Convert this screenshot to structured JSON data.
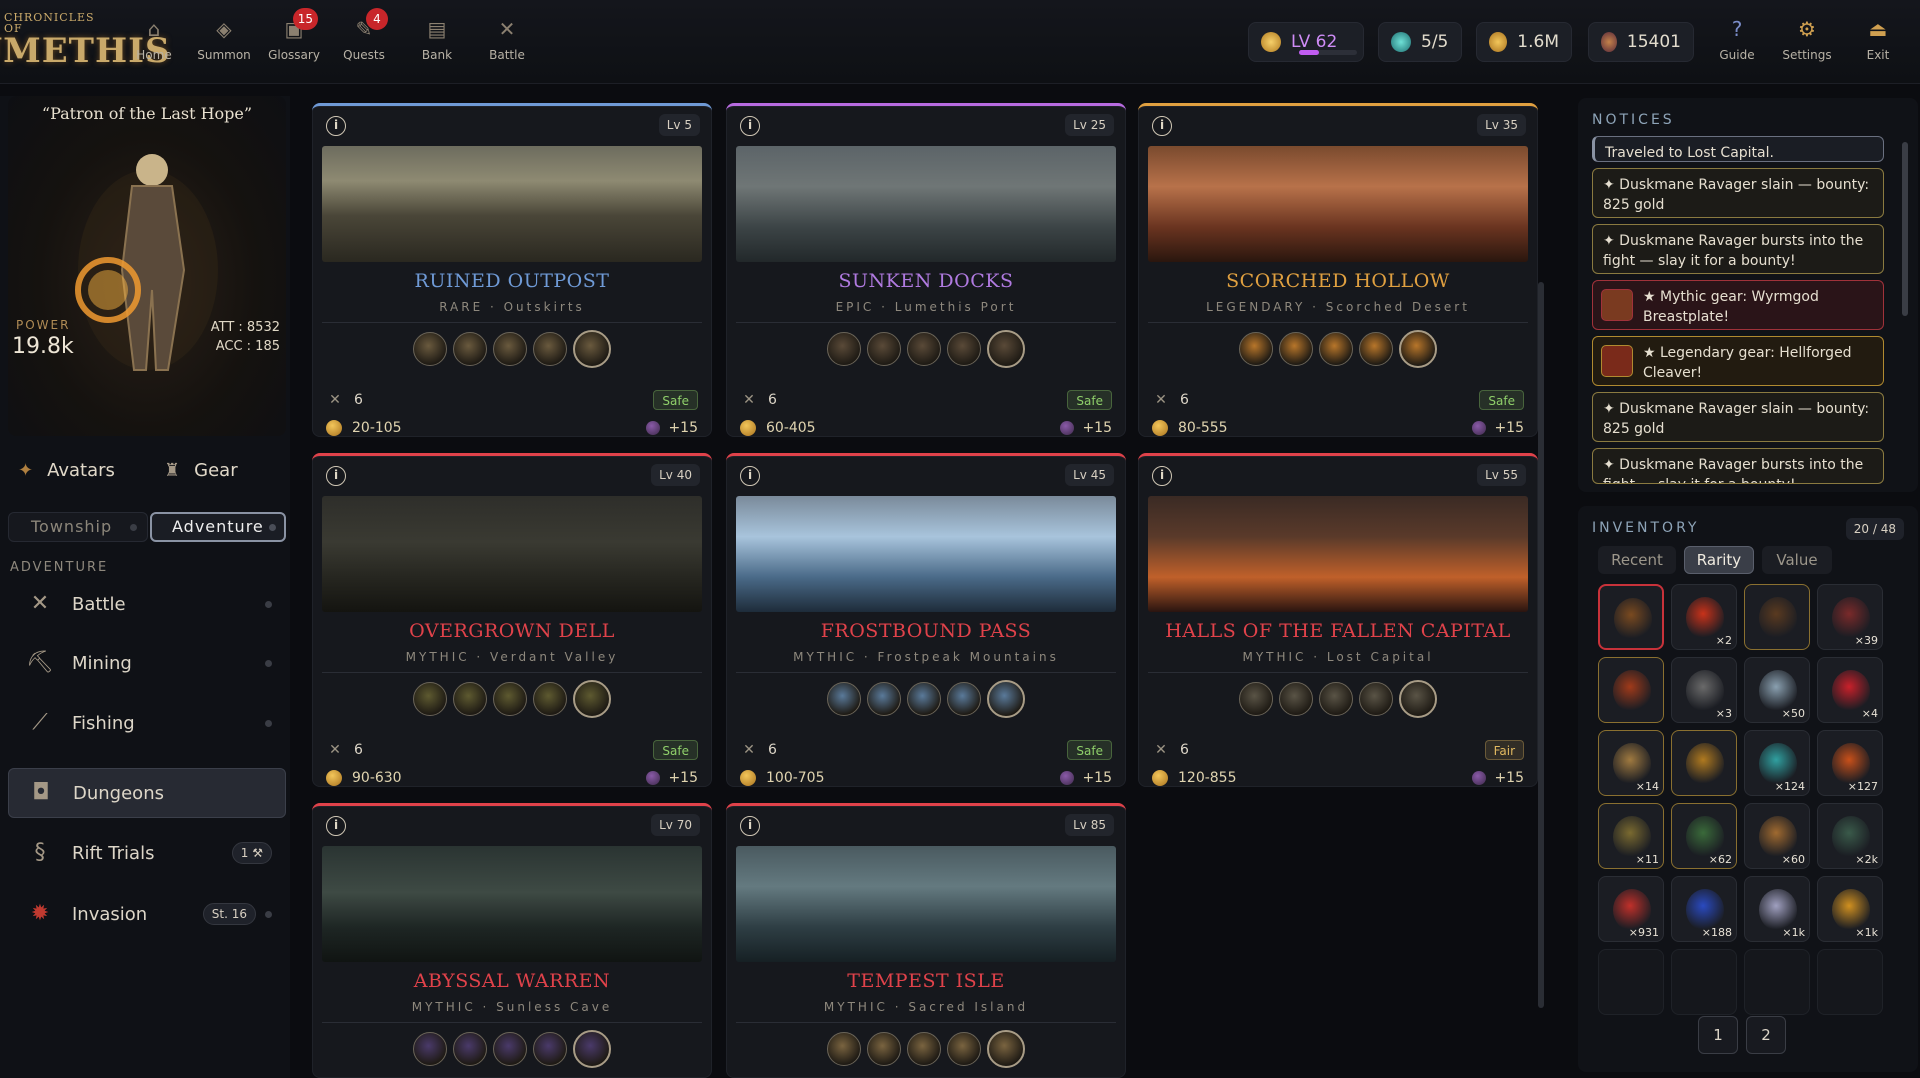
{
  "app": {
    "logo_line1": "CHRONICLES OF",
    "logo_line2": "LUMETHIS"
  },
  "nav": {
    "home": "Home",
    "summon": "Summon",
    "glossary": "Glossary",
    "glossary_badge": "15",
    "quests": "Quests",
    "quests_badge": "4",
    "bank": "Bank",
    "battle": "Battle",
    "guide": "Guide",
    "settings": "Settings",
    "exit": "Exit"
  },
  "resources": {
    "level": "LV 62",
    "level_progress": 0.35,
    "energy": "5/5",
    "gold": "1.6M",
    "gems": "15401"
  },
  "hero": {
    "title": "“Patron of the Last Hope”",
    "power_label": "POWER",
    "power": "19.8k",
    "att": "ATT : 8532",
    "acc": "ACC : 185"
  },
  "left": {
    "avatars": "Avatars",
    "gear": "Gear",
    "tab_township": "Township",
    "tab_adventure": "Adventure",
    "section": "ADVENTURE",
    "items": [
      {
        "label": "Battle"
      },
      {
        "label": "Mining"
      },
      {
        "label": "Fishing"
      },
      {
        "label": "Dungeons"
      },
      {
        "label": "Rift Trials",
        "tag": "1 ⚒"
      },
      {
        "label": "Invasion",
        "tag": "St. 16"
      }
    ]
  },
  "dungeons": [
    {
      "lv": "Lv 5",
      "name": "RUINED OUTPOST",
      "sub": "RARE · Outskirts",
      "players": "6",
      "status": "Safe",
      "gold": "20-105",
      "bonus": "+15"
    },
    {
      "lv": "Lv 25",
      "name": "SUNKEN DOCKS",
      "sub": "EPIC · Lumethis Port",
      "players": "6",
      "status": "Safe",
      "gold": "60-405",
      "bonus": "+15"
    },
    {
      "lv": "Lv 35",
      "name": "SCORCHED HOLLOW",
      "sub": "LEGENDARY · Scorched Desert",
      "players": "6",
      "status": "Safe",
      "gold": "80-555",
      "bonus": "+15"
    },
    {
      "lv": "Lv 40",
      "name": "OVERGROWN DELL",
      "sub": "MYTHIC · Verdant Valley",
      "players": "6",
      "status": "Safe",
      "gold": "90-630",
      "bonus": "+15"
    },
    {
      "lv": "Lv 45",
      "name": "FROSTBOUND PASS",
      "sub": "MYTHIC · Frostpeak Mountains",
      "players": "6",
      "status": "Safe",
      "gold": "100-705",
      "bonus": "+15"
    },
    {
      "lv": "Lv 55",
      "name": "HALLS OF THE FALLEN CAPITAL",
      "sub": "MYTHIC · Lost Capital",
      "players": "6",
      "status": "Fair",
      "gold": "120-855",
      "bonus": "+15"
    },
    {
      "lv": "Lv 70",
      "name": "ABYSSAL WARREN",
      "sub": "MYTHIC · Sunless Cave"
    },
    {
      "lv": "Lv 85",
      "name": "TEMPEST ISLE",
      "sub": "MYTHIC · Sacred Island"
    }
  ],
  "notices": {
    "title": "NOTICES",
    "items": [
      "Traveled to Lost Capital.",
      "✦ Duskmane Ravager slain — bounty: 825 gold",
      "✦ Duskmane Ravager bursts into the fight — slay it for a bounty!",
      "★ Mythic gear: Wyrmgod Breastplate!",
      "★ Legendary gear: Hellforged Cleaver!",
      "✦ Duskmane Ravager slain — bounty: 825 gold",
      "✦ Duskmane Ravager bursts into the fight — slay it for a bounty!"
    ]
  },
  "inventory": {
    "title": "INVENTORY",
    "count": "20 / 48",
    "tabs": [
      "Recent",
      "Rarity",
      "Value"
    ],
    "counts": [
      "",
      "×2",
      "",
      "×39",
      "",
      "×3",
      "×50",
      "×4",
      "×14",
      "",
      "×124",
      "×127",
      "×11",
      "×62",
      "×60",
      "×2k",
      "×931",
      "×188",
      "×1k",
      "×1k"
    ],
    "pages": [
      "1",
      "2"
    ]
  },
  "colors": {
    "rare": "#6f9ad6",
    "epic": "#b76be0",
    "legendary": "#e0a040",
    "mythic": "#e0424a",
    "safe": "#8fcf6a",
    "fair": "#e0b860"
  }
}
